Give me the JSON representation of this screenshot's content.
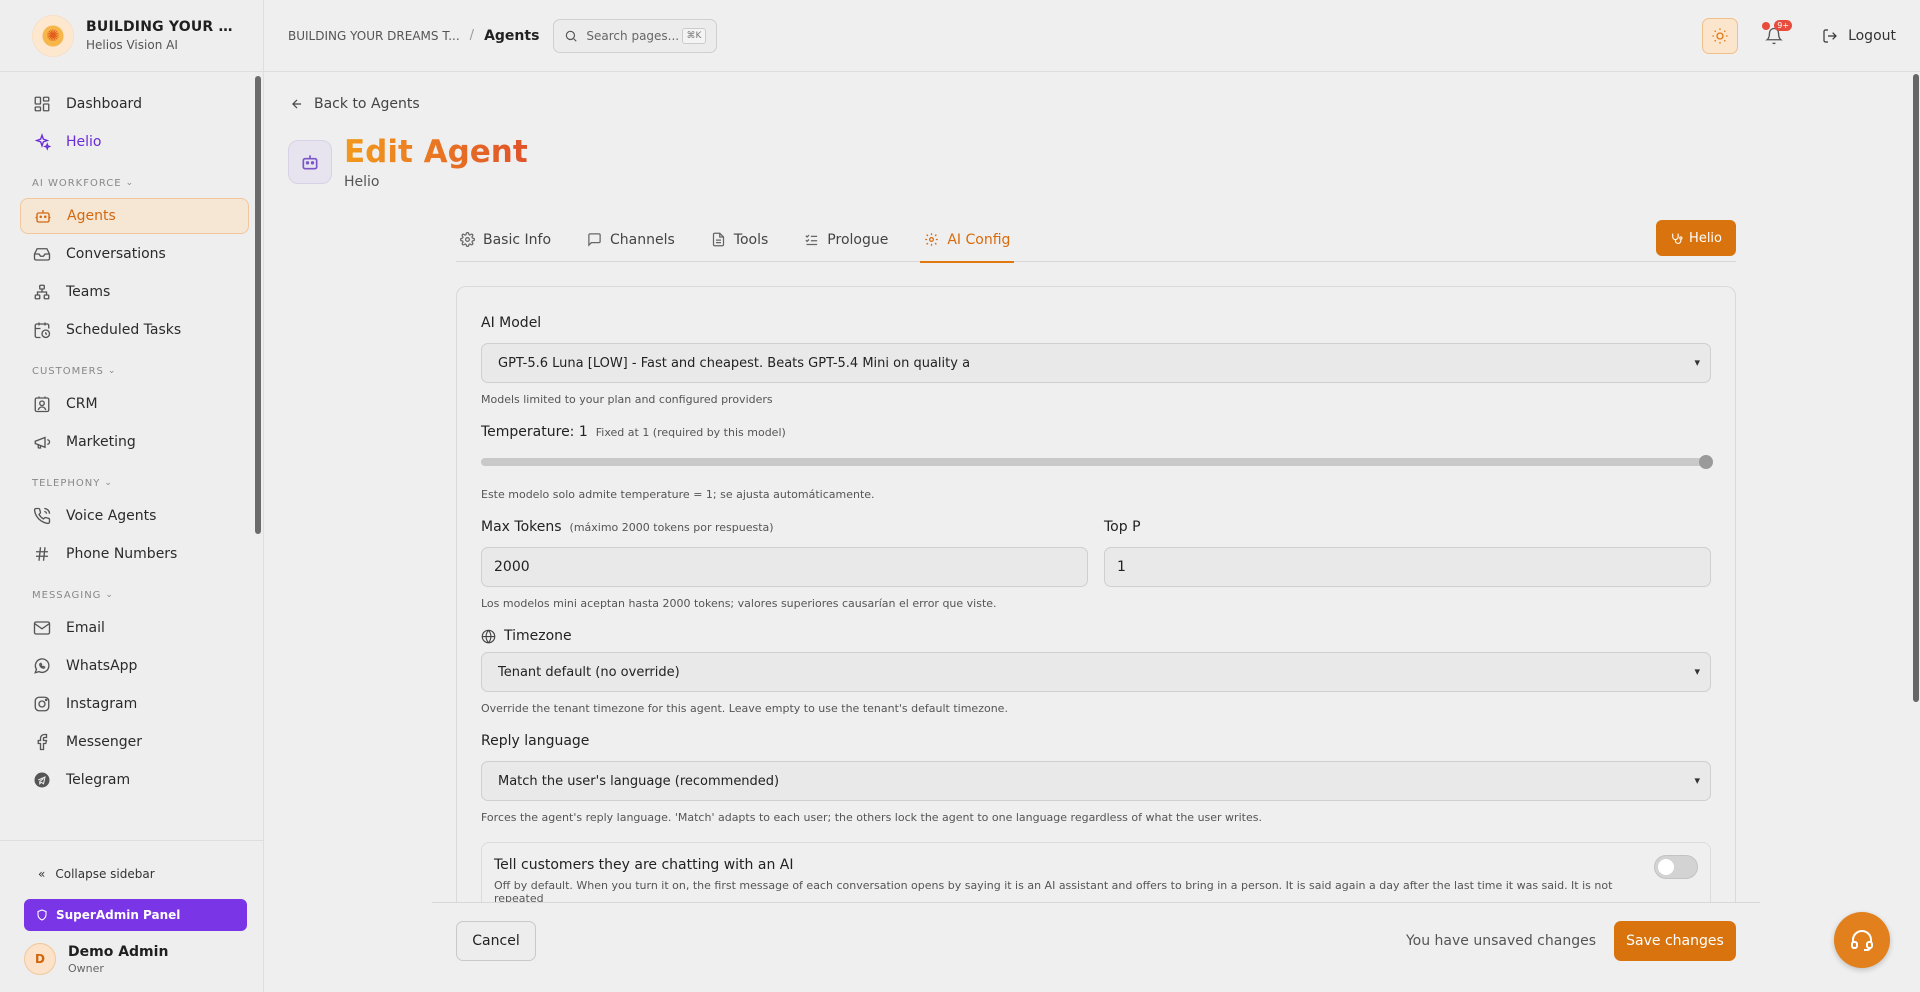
{
  "brand": {
    "title": "BUILDING YOUR DREAMS",
    "title_display": "BUILDING YOUR DRE...",
    "subtitle": "Helios Vision AI"
  },
  "sidebar": {
    "items_top": [
      {
        "label": "Dashboard",
        "icon": "dashboard-icon"
      },
      {
        "label": "Helio",
        "icon": "sparkles-icon"
      }
    ],
    "sections": [
      {
        "title": "AI WORKFORCE",
        "items": [
          {
            "label": "Agents",
            "icon": "bot-icon",
            "active": true
          },
          {
            "label": "Conversations",
            "icon": "inbox-icon"
          },
          {
            "label": "Teams",
            "icon": "teams-icon"
          },
          {
            "label": "Scheduled Tasks",
            "icon": "calendar-clock-icon"
          }
        ]
      },
      {
        "title": "CUSTOMERS",
        "items": [
          {
            "label": "CRM",
            "icon": "contact-icon"
          },
          {
            "label": "Marketing",
            "icon": "megaphone-icon"
          }
        ]
      },
      {
        "title": "TELEPHONY",
        "items": [
          {
            "label": "Voice Agents",
            "icon": "phone-icon"
          },
          {
            "label": "Phone Numbers",
            "icon": "hash-icon"
          }
        ]
      },
      {
        "title": "MESSAGING",
        "items": [
          {
            "label": "Email",
            "icon": "mail-icon"
          },
          {
            "label": "WhatsApp",
            "icon": "whatsapp-icon"
          },
          {
            "label": "Instagram",
            "icon": "instagram-icon"
          },
          {
            "label": "Messenger",
            "icon": "facebook-icon"
          },
          {
            "label": "Telegram",
            "icon": "telegram-icon"
          }
        ]
      }
    ],
    "collapse_label": "Collapse sidebar",
    "superadmin_label": "SuperAdmin Panel",
    "user": {
      "initial": "D",
      "name": "Demo Admin",
      "role": "Owner"
    }
  },
  "header": {
    "breadcrumb_root": "BUILDING YOUR DREAMS T...",
    "breadcrumb_sep": "/",
    "breadcrumb_current": "Agents",
    "search_placeholder": "Search pages...",
    "search_shortcut": "⌘K",
    "notification_badge": "9+",
    "logout_label": "Logout"
  },
  "page": {
    "back_label": "Back to Agents",
    "title": "Edit Agent",
    "subtitle": "Helio",
    "helio_button": "Helio",
    "tabs": [
      {
        "label": "Basic Info",
        "icon": "gear-icon"
      },
      {
        "label": "Channels",
        "icon": "message-square-icon"
      },
      {
        "label": "Tools",
        "icon": "file-icon"
      },
      {
        "label": "Prologue",
        "icon": "list-check-icon"
      },
      {
        "label": "AI Config",
        "icon": "gear-icon",
        "active": true
      }
    ]
  },
  "form": {
    "ai_model_label": "AI Model",
    "ai_model_value": "GPT-5.6 Luna [LOW] - Fast and cheapest. Beats GPT-5.4 Mini on quality a",
    "ai_model_help": "Models limited to your plan and configured providers",
    "temperature_label": "Temperature: 1",
    "temperature_note": "Fixed at 1 (required by this model)",
    "temperature_value": 1,
    "temperature_help": "Este modelo solo admite temperature = 1; se ajusta automáticamente.",
    "max_tokens_label": "Max Tokens",
    "max_tokens_note": "(máximo 2000 tokens por respuesta)",
    "max_tokens_value": "2000",
    "top_p_label": "Top P",
    "top_p_value": "1",
    "tokens_help": "Los modelos mini aceptan hasta 2000 tokens; valores superiores causarían el error que viste.",
    "timezone_label": "Timezone",
    "timezone_value": "Tenant default (no override)",
    "timezone_help": "Override the tenant timezone for this agent. Leave empty to use the tenant's default timezone.",
    "reply_language_label": "Reply language",
    "reply_language_value": "Match the user's language (recommended)",
    "reply_language_help": "Forces the agent's reply language. 'Match' adapts to each user; the others lock the agent to one language regardless of what the user writes.",
    "ai_disclosure_title": "Tell customers they are chatting with an AI",
    "ai_disclosure_desc": "Off by default. When you turn it on, the first message of each conversation opens by saying it is an AI assistant and offers to bring in a person. It is said again a day after the last time it was said. It is not repeated",
    "ai_disclosure_enabled": false
  },
  "footer": {
    "cancel_label": "Cancel",
    "unsaved_label": "You have unsaved changes",
    "save_label": "Save changes"
  },
  "colors": {
    "accent": "#d9730d",
    "purple": "#7a35e6",
    "helio_text": "#6a2bd8"
  }
}
